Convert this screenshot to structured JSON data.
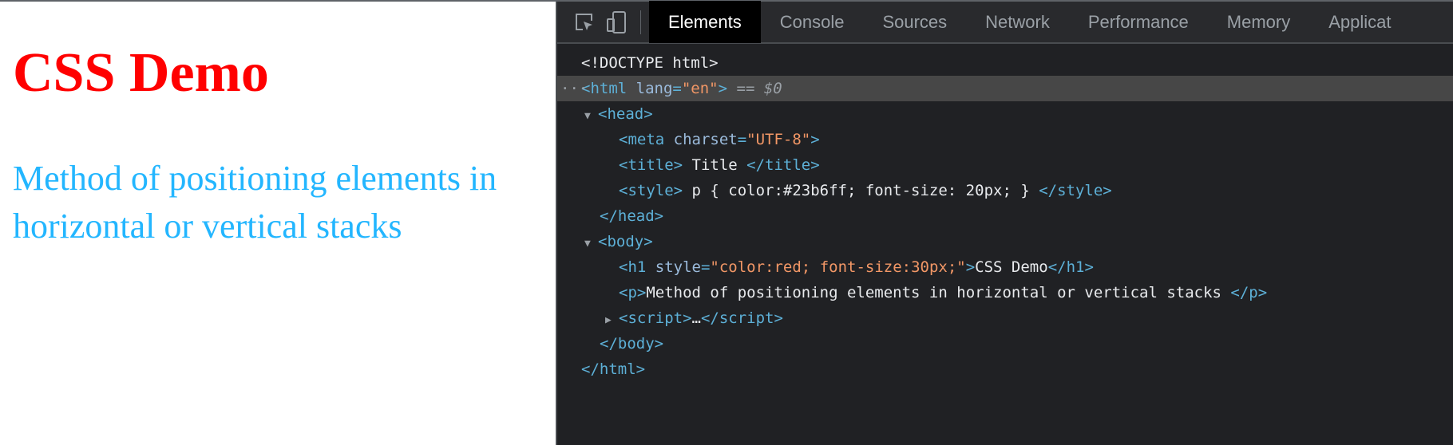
{
  "page": {
    "heading": "CSS Demo",
    "paragraph": "Method of positioning elements in horizontal or vertical stacks",
    "heading_color": "#ff0000",
    "paragraph_color": "#23b6ff"
  },
  "devtools": {
    "tabs": [
      "Elements",
      "Console",
      "Sources",
      "Network",
      "Performance",
      "Memory",
      "Applicat"
    ],
    "active_tab": "Elements",
    "tree": {
      "doctype": "<!DOCTYPE html>",
      "html_open": "<html",
      "html_attr": " lang",
      "html_val": "\"en\"",
      "html_close": ">",
      "selected_marker": " == $0",
      "head_open": "<head>",
      "meta_tag": "<meta",
      "meta_attr": " charset",
      "meta_val": "\"UTF-8\"",
      "meta_close": ">",
      "title_open": "<title>",
      "title_text": " Title ",
      "title_close": "</title>",
      "style_open": "<style>",
      "style_text": " p { color:#23b6ff; font-size: 20px; } ",
      "style_close": "</style>",
      "head_close": "</head>",
      "body_open": "<body>",
      "h1_open": "<h1",
      "h1_attr": " style",
      "h1_val": "\"color:red; font-size:30px;\"",
      "h1_gt": ">",
      "h1_text": "CSS Demo",
      "h1_close": "</h1>",
      "p_open": "<p>",
      "p_text": "Method of positioning elements in horizontal or vertical stacks ",
      "p_close": "</p>",
      "script_open": "<script>",
      "script_ellipsis": "…",
      "script_close": "</script>",
      "body_close": "</body>",
      "html_end": "</html>"
    }
  }
}
